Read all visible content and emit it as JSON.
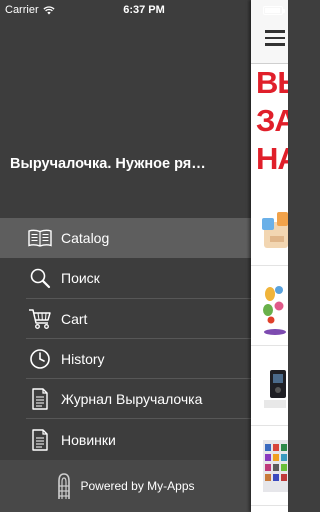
{
  "status_bar": {
    "carrier": "Carrier",
    "time": "6:37 PM"
  },
  "app": {
    "title": "Выручалочка. Нужное ря…"
  },
  "menu": {
    "items": [
      {
        "label": "Catalog",
        "icon": "book-icon",
        "active": true
      },
      {
        "label": "Поиск",
        "icon": "search-icon",
        "active": false
      },
      {
        "label": "Cart",
        "icon": "cart-icon",
        "active": false
      },
      {
        "label": "History",
        "icon": "clock-icon",
        "active": false
      },
      {
        "label": "Журнал Выручалочка",
        "icon": "document-icon",
        "active": false
      },
      {
        "label": "Новинки",
        "icon": "document-icon",
        "active": false
      }
    ]
  },
  "footer": {
    "text": "Powered by My-Apps",
    "icon": "my-apps-logo-icon"
  },
  "main_panel": {
    "menu_icon": "hamburger-icon",
    "banner_lines": [
      "ВЬ",
      "ЗА",
      "НА"
    ],
    "banner_color": "#e01f2a"
  },
  "colors": {
    "menu_bg": "#3d3d3d",
    "active_item_bg": "#5e5e5e",
    "footer_bg": "#484848"
  }
}
